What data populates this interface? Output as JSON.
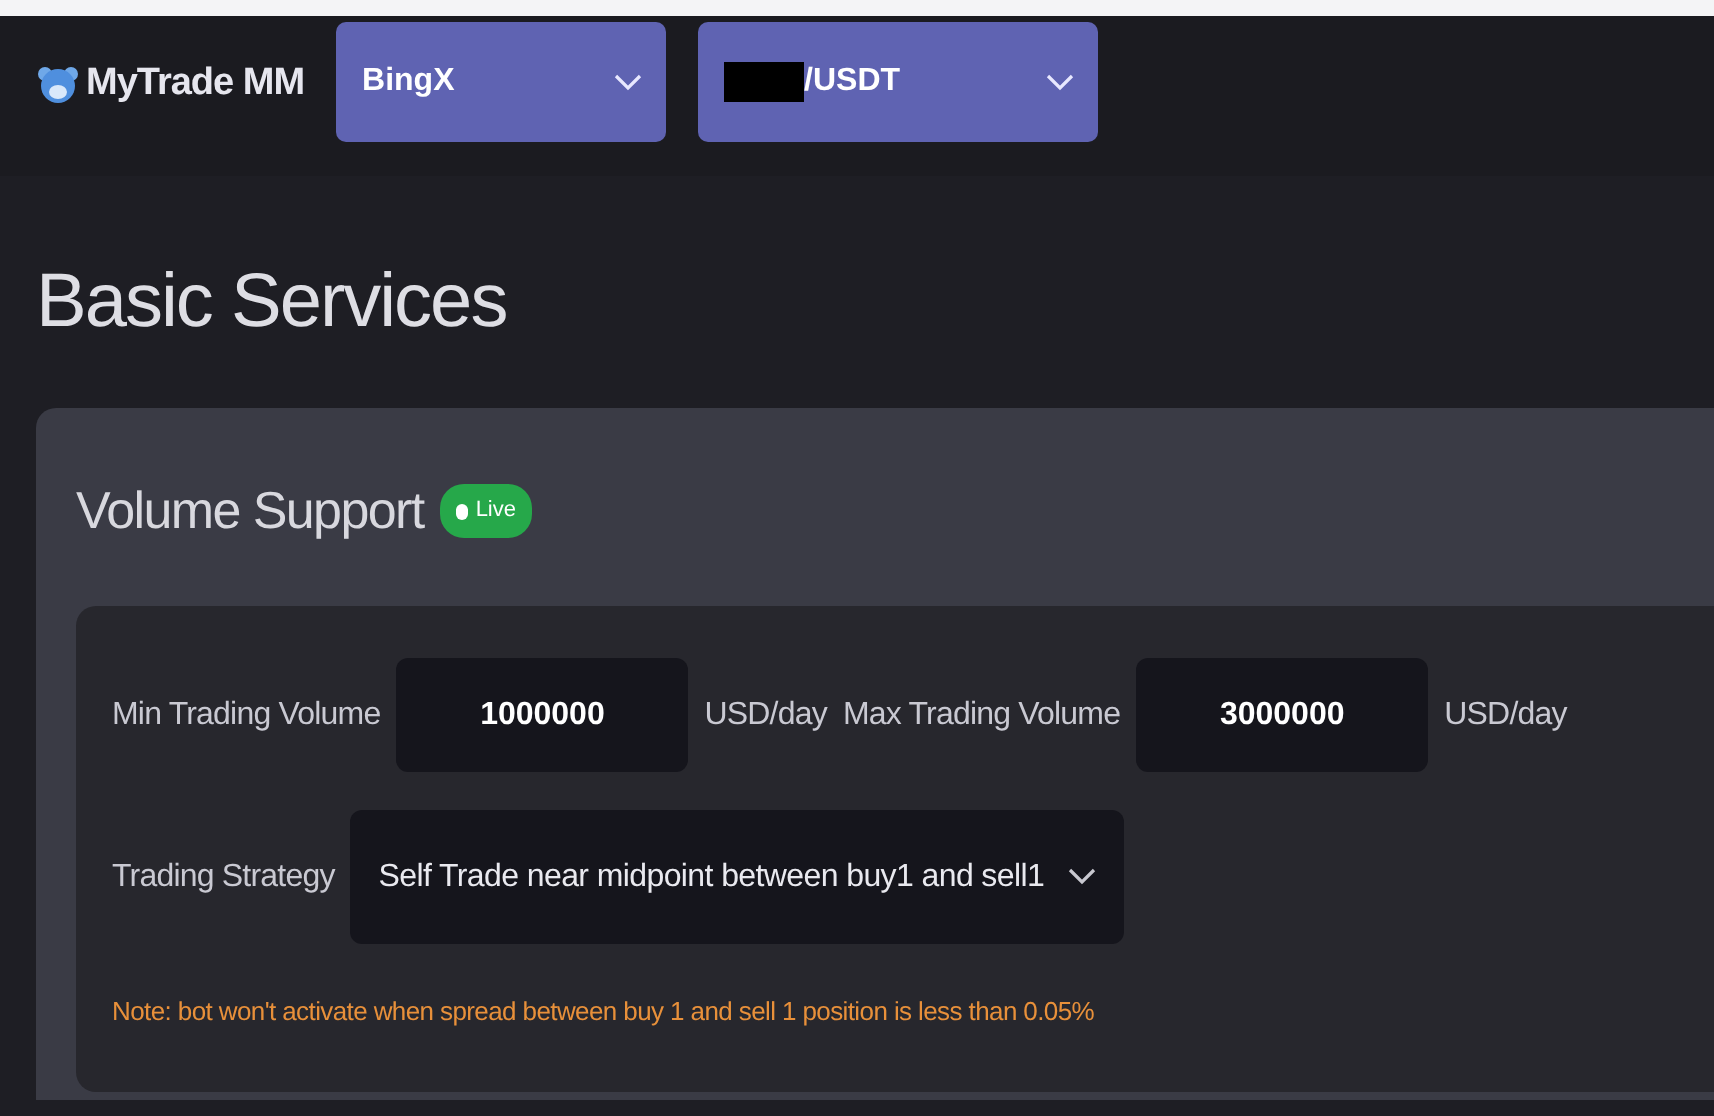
{
  "header": {
    "brand": "MyTrade MM",
    "selects": [
      {
        "kind": "plain",
        "value": "BingX"
      },
      {
        "kind": "redacted",
        "value": "/USDT"
      }
    ]
  },
  "page_title": "Basic Services",
  "card": {
    "title": "Volume Support",
    "status": {
      "label": "Live",
      "live": true
    },
    "volume_row": [
      {
        "kind": "label",
        "text": "Min Trading Volume"
      },
      {
        "kind": "input",
        "value": "1000000"
      },
      {
        "kind": "label",
        "text": "USD/day"
      },
      {
        "kind": "label",
        "text": "Max Trading Volume"
      },
      {
        "kind": "input",
        "value": "3000000"
      },
      {
        "kind": "label",
        "text": "USD/day"
      }
    ],
    "strategy": {
      "label": "Trading Strategy",
      "value": "Self Trade near midpoint between buy1 and sell1"
    },
    "note": "Note: bot won't activate when spread between buy 1 and sell 1 position is less than 0.05%"
  }
}
